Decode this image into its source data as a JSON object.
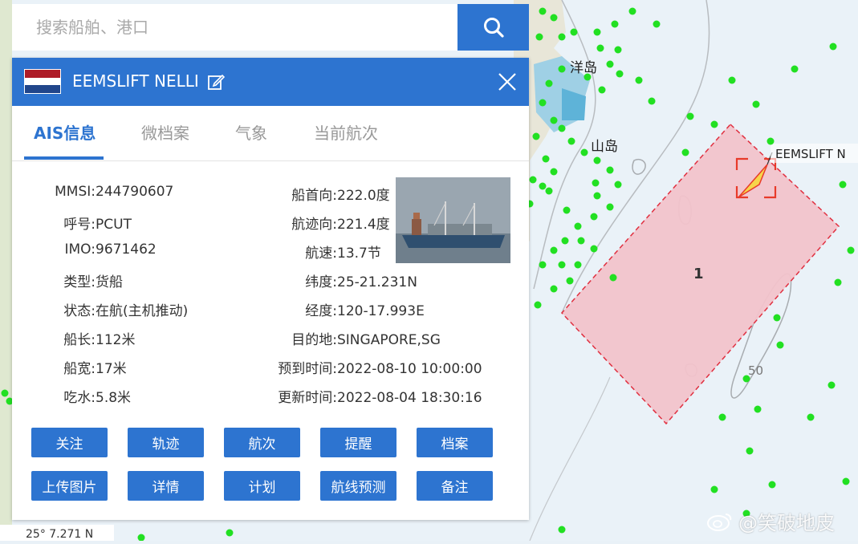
{
  "search": {
    "placeholder": "搜索船舶、港口"
  },
  "ship": {
    "name": "EEMSLIFT NELLI",
    "flag_colors": [
      "#ae1c28",
      "#ffffff",
      "#21468b"
    ]
  },
  "tabs": [
    {
      "label": "AIS信息",
      "active": true
    },
    {
      "label": "微档案"
    },
    {
      "label": "气象"
    },
    {
      "label": "当前航次"
    }
  ],
  "info_left": [
    {
      "label": "MMSI:",
      "value": "244790607"
    },
    {
      "label": "呼号:",
      "value": "PCUT"
    },
    {
      "label": "IMO:",
      "value": "9671462"
    },
    {
      "label": "类型:",
      "value": "货船"
    },
    {
      "label": "状态:",
      "value": "在航(主机推动)"
    },
    {
      "label": "船长:",
      "value": "112米"
    },
    {
      "label": "船宽:",
      "value": "17米"
    },
    {
      "label": "吃水:",
      "value": "5.8米"
    }
  ],
  "info_right": [
    {
      "label": "船首向:",
      "value": "222.0度"
    },
    {
      "label": "航迹向:",
      "value": "221.4度"
    },
    {
      "label": "航速:",
      "value": "13.7节"
    },
    {
      "label": "纬度:",
      "value": "25-21.231N"
    },
    {
      "label": "经度:",
      "value": "120-17.993E"
    },
    {
      "label": "目的地:",
      "value": "SINGAPORE,SG"
    },
    {
      "label": "预到时间:",
      "value": "2022-08-10 10:00:00"
    },
    {
      "label": "更新时间:",
      "value": "2022-08-04 18:30:16"
    }
  ],
  "buttons": [
    "关注",
    "轨迹",
    "航次",
    "提醒",
    "档案",
    "上传图片",
    "详情",
    "计划",
    "航线预测",
    "备注"
  ],
  "map": {
    "zone_label": "1",
    "ship_label": "EEMSLIFT N",
    "place_1": "洋岛",
    "place_2": "山岛",
    "depth_label": "50",
    "coord_text": "25° 7.271 N"
  },
  "watermark": "@笑破地皮",
  "colors": {
    "accent": "#2d74d0",
    "zone_fill": "#f2c3cb",
    "zone_border": "#e03040",
    "ship_marker": "#22e022"
  }
}
